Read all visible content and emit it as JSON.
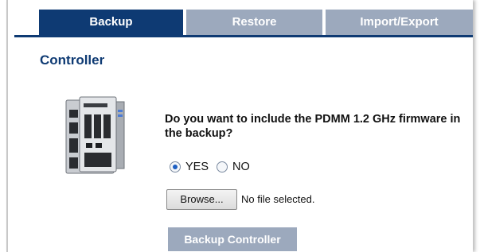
{
  "tabs": [
    {
      "label": "Backup",
      "active": true
    },
    {
      "label": "Restore",
      "active": false
    },
    {
      "label": "Import/Export",
      "active": false
    }
  ],
  "section": {
    "title": "Controller"
  },
  "device": {
    "icon": "controller-device-image"
  },
  "question": "Do you want to include the PDMM 1.2 GHz firmware in the backup?",
  "radios": {
    "yes_label": "YES",
    "no_label": "NO",
    "selected": "YES"
  },
  "file": {
    "browse_label": "Browse...",
    "status": "No file selected."
  },
  "action": {
    "label": "Backup Controller"
  },
  "colors": {
    "accent": "#0e3a73",
    "inactive_tab": "#9ca9bd"
  }
}
